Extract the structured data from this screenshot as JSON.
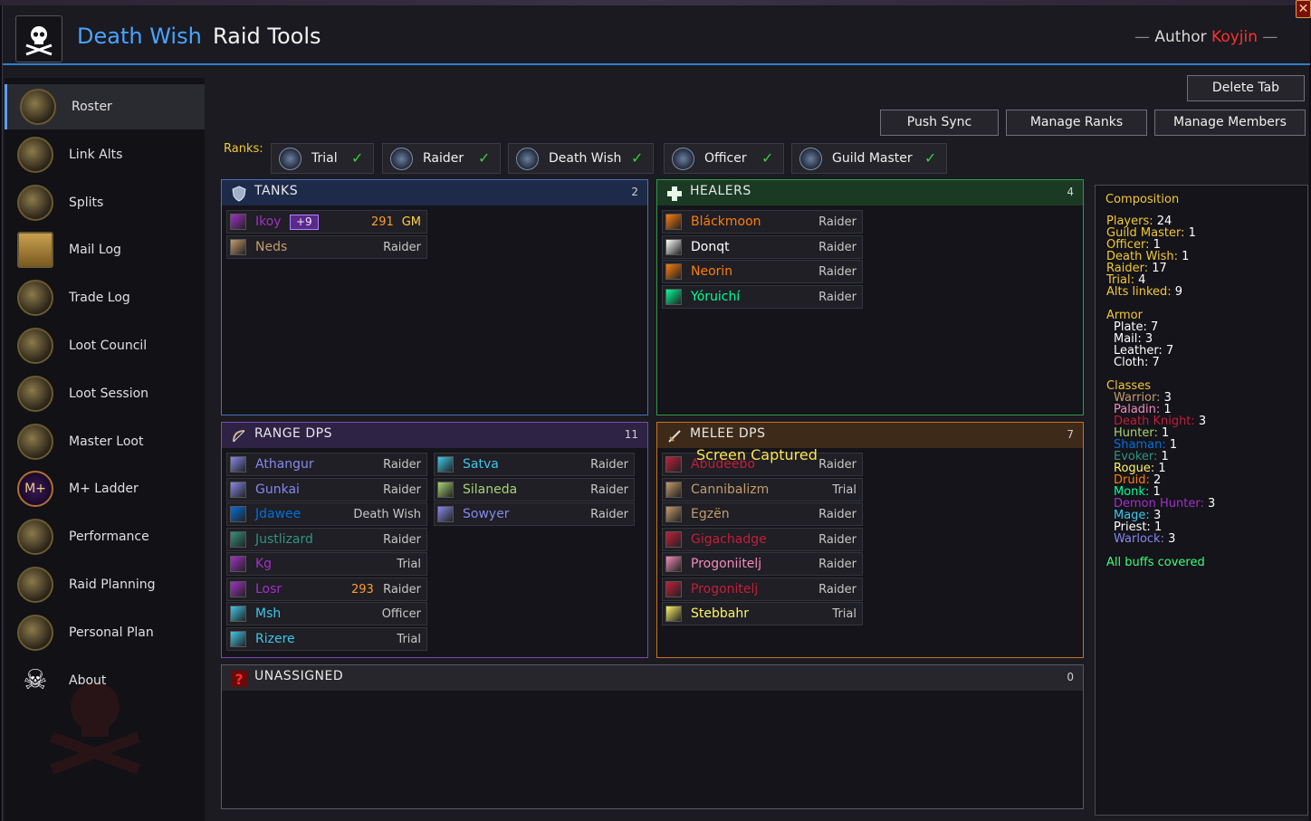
{
  "header": {
    "title_primary": "Death Wish",
    "title_secondary": "Raid Tools",
    "author_label": "Author",
    "author_name": "Koyjin",
    "close_glyph": "✕"
  },
  "sidebar": {
    "items": [
      {
        "label": "Roster",
        "icon": "roster-icon",
        "active": true
      },
      {
        "label": "Link Alts",
        "icon": "link-alts-icon"
      },
      {
        "label": "Splits",
        "icon": "splits-icon"
      },
      {
        "label": "Mail Log",
        "icon": "mail-icon"
      },
      {
        "label": "Trade Log",
        "icon": "trade-icon"
      },
      {
        "label": "Loot Council",
        "icon": "loot-council-icon"
      },
      {
        "label": "Loot Session",
        "icon": "loot-session-icon"
      },
      {
        "label": "Master Loot",
        "icon": "master-loot-icon"
      },
      {
        "label": "M+ Ladder",
        "icon": "mplus-icon",
        "glyph": "M+"
      },
      {
        "label": "Performance",
        "icon": "performance-icon"
      },
      {
        "label": "Raid Planning",
        "icon": "raid-planning-icon"
      },
      {
        "label": "Personal Plan",
        "icon": "personal-plan-icon"
      },
      {
        "label": "About",
        "icon": "skull-icon"
      }
    ]
  },
  "toolbar": {
    "delete_tab": "Delete Tab",
    "push_sync": "Push Sync",
    "manage_ranks": "Manage Ranks",
    "manage_members": "Manage Members"
  },
  "ranks": {
    "label": "Ranks:",
    "items": [
      {
        "name": "Trial",
        "checked": true
      },
      {
        "name": "Raider",
        "checked": true
      },
      {
        "name": "Death Wish",
        "checked": true
      },
      {
        "name": "Officer",
        "checked": true
      },
      {
        "name": "Guild Master",
        "checked": true
      }
    ]
  },
  "panels": {
    "tanks": {
      "title": "TANKS",
      "count": "2"
    },
    "healers": {
      "title": "HEALERS",
      "count": "4"
    },
    "range": {
      "title": "RANGE DPS",
      "count": "11"
    },
    "melee": {
      "title": "MELEE DPS",
      "count": "7"
    },
    "unassigned": {
      "title": "UNASSIGNED",
      "count": "0"
    }
  },
  "tanks": [
    {
      "name": "Ikoy",
      "color": "#a330c9",
      "badge": "+9",
      "ilvl": "291",
      "rank": "GM"
    },
    {
      "name": "Neds",
      "color": "#c69b6d",
      "rank": "Raider"
    }
  ],
  "healers": [
    {
      "name": "Bláckmoon",
      "color": "#ff7d0a",
      "rank": "Raider"
    },
    {
      "name": "Donqt",
      "color": "#ffffff",
      "rank": "Raider"
    },
    {
      "name": "Neorin",
      "color": "#ff7d0a",
      "rank": "Raider"
    },
    {
      "name": "Yóruichí",
      "color": "#00ff98",
      "rank": "Raider"
    }
  ],
  "range": [
    {
      "name": "Athangur",
      "color": "#8788ee",
      "rank": "Raider"
    },
    {
      "name": "Gunkai",
      "color": "#8788ee",
      "rank": "Raider"
    },
    {
      "name": "Jdawee",
      "color": "#0070dd",
      "rank": "Death Wish"
    },
    {
      "name": "Justlizard",
      "color": "#33937f",
      "rank": "Raider"
    },
    {
      "name": "Kg",
      "color": "#a330c9",
      "rank": "Trial"
    },
    {
      "name": "Losr",
      "color": "#a330c9",
      "ilvl": "293",
      "rank": "Raider"
    },
    {
      "name": "Msh",
      "color": "#3fc7eb",
      "rank": "Officer"
    },
    {
      "name": "Rizere",
      "color": "#3fc7eb",
      "rank": "Trial"
    },
    {
      "name": "Satva",
      "color": "#3fc7eb",
      "rank": "Raider"
    },
    {
      "name": "Silaneda",
      "color": "#aad372",
      "rank": "Raider"
    },
    {
      "name": "Sowyer",
      "color": "#8788ee",
      "rank": "Raider"
    }
  ],
  "melee": [
    {
      "name": "Abudeebo",
      "color": "#c41e3a",
      "rank": "Raider"
    },
    {
      "name": "Cannibalizm",
      "color": "#c69b6d",
      "rank": "Trial"
    },
    {
      "name": "Egzën",
      "color": "#c69b6d",
      "rank": "Raider"
    },
    {
      "name": "Gigachadge",
      "color": "#c41e3a",
      "rank": "Raider"
    },
    {
      "name": "Progoniitelj",
      "color": "#f48cba",
      "rank": "Raider"
    },
    {
      "name": "Progonitelj",
      "color": "#c41e3a",
      "rank": "Raider"
    },
    {
      "name": "Stebbahr",
      "color": "#fff468",
      "rank": "Trial"
    }
  ],
  "composition": {
    "title": "Composition",
    "summary": [
      {
        "k": "Players:",
        "v": "24"
      },
      {
        "k": "Guild Master:",
        "v": "1"
      },
      {
        "k": "Officer:",
        "v": "1"
      },
      {
        "k": "Death Wish:",
        "v": "1"
      },
      {
        "k": "Raider:",
        "v": "17"
      },
      {
        "k": "Trial:",
        "v": "4"
      },
      {
        "k": "Alts linked:",
        "v": "9"
      }
    ],
    "armor_title": "Armor",
    "armor": [
      {
        "k": "Plate:",
        "v": "7"
      },
      {
        "k": "Mail:",
        "v": "3"
      },
      {
        "k": "Leather:",
        "v": "7"
      },
      {
        "k": "Cloth:",
        "v": "7"
      }
    ],
    "classes_title": "Classes",
    "classes": [
      {
        "k": "Warrior:",
        "v": "3",
        "color": "#c69b6d"
      },
      {
        "k": "Paladin:",
        "v": "1",
        "color": "#f48cba"
      },
      {
        "k": "Death Knight:",
        "v": "3",
        "color": "#c41e3a"
      },
      {
        "k": "Hunter:",
        "v": "1",
        "color": "#aad372"
      },
      {
        "k": "Shaman:",
        "v": "1",
        "color": "#0070dd"
      },
      {
        "k": "Evoker:",
        "v": "1",
        "color": "#33937f"
      },
      {
        "k": "Rogue:",
        "v": "1",
        "color": "#fff468"
      },
      {
        "k": "Druid:",
        "v": "2",
        "color": "#ff7d0a"
      },
      {
        "k": "Monk:",
        "v": "1",
        "color": "#00ff98"
      },
      {
        "k": "Demon Hunter:",
        "v": "3",
        "color": "#a330c9"
      },
      {
        "k": "Mage:",
        "v": "3",
        "color": "#3fc7eb"
      },
      {
        "k": "Priest:",
        "v": "1",
        "color": "#ffffff"
      },
      {
        "k": "Warlock:",
        "v": "3",
        "color": "#8788ee"
      }
    ],
    "buffs": "All buffs covered"
  },
  "overlay": {
    "screen_captured": "Screen Captured"
  }
}
